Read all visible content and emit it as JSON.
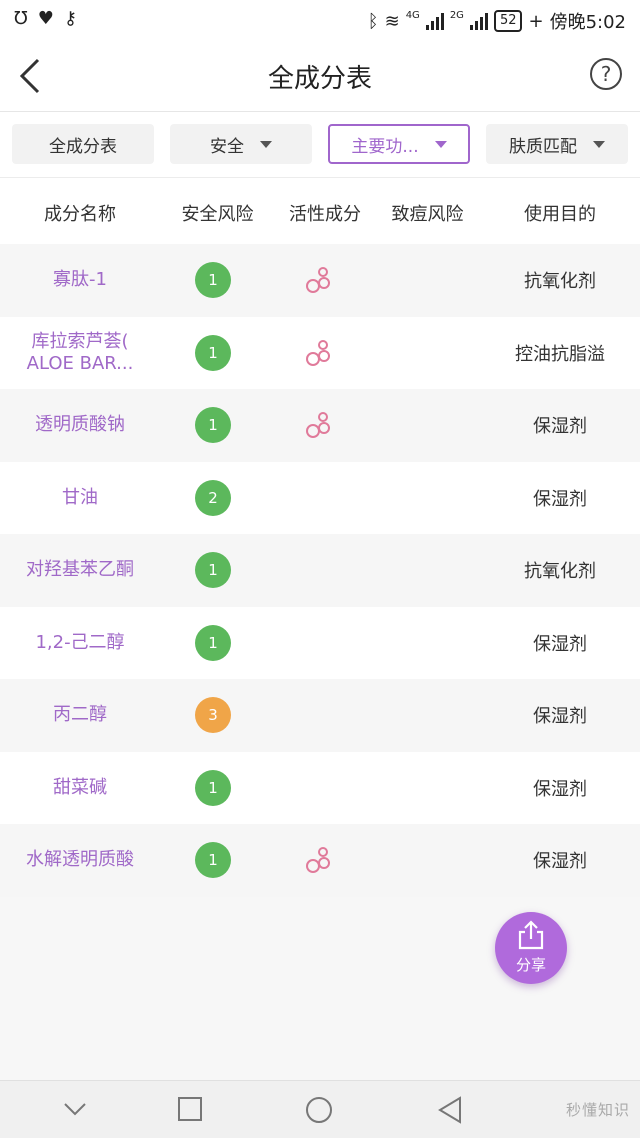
{
  "status_bar": {
    "time": "傍晚5:02",
    "battery": "52",
    "net_a": "4G",
    "net_b": "2G"
  },
  "header": {
    "title": "全成分表",
    "help_glyph": "?"
  },
  "filters": {
    "all": "全成分表",
    "safety": "安全",
    "function": "主要功...",
    "skin": "肤质匹配"
  },
  "columns": {
    "name": "成分名称",
    "risk": "安全风险",
    "active": "活性成分",
    "acne": "致痘风险",
    "purpose": "使用目的"
  },
  "rows": [
    {
      "name": "寡肽-1",
      "risk": "1",
      "risk_color": "green",
      "active": true,
      "purpose": "抗氧化剂"
    },
    {
      "name": "库拉索芦荟( ALOE BAR...",
      "risk": "1",
      "risk_color": "green",
      "active": true,
      "purpose": "控油抗脂溢"
    },
    {
      "name": "透明质酸钠",
      "risk": "1",
      "risk_color": "green",
      "active": true,
      "purpose": "保湿剂"
    },
    {
      "name": "甘油",
      "risk": "2",
      "risk_color": "green",
      "active": false,
      "purpose": "保湿剂"
    },
    {
      "name": "对羟基苯乙酮",
      "risk": "1",
      "risk_color": "green",
      "active": false,
      "purpose": "抗氧化剂"
    },
    {
      "name": "1,2-己二醇",
      "risk": "1",
      "risk_color": "green",
      "active": false,
      "purpose": "保湿剂"
    },
    {
      "name": "丙二醇",
      "risk": "3",
      "risk_color": "orange",
      "active": false,
      "purpose": "保湿剂"
    },
    {
      "name": "甜菜碱",
      "risk": "1",
      "risk_color": "green",
      "active": false,
      "purpose": "保湿剂"
    },
    {
      "name": "水解透明质酸",
      "risk": "1",
      "risk_color": "green",
      "active": true,
      "purpose": "保湿剂"
    }
  ],
  "share": {
    "label": "分享"
  },
  "watermark": "秒懂知识"
}
